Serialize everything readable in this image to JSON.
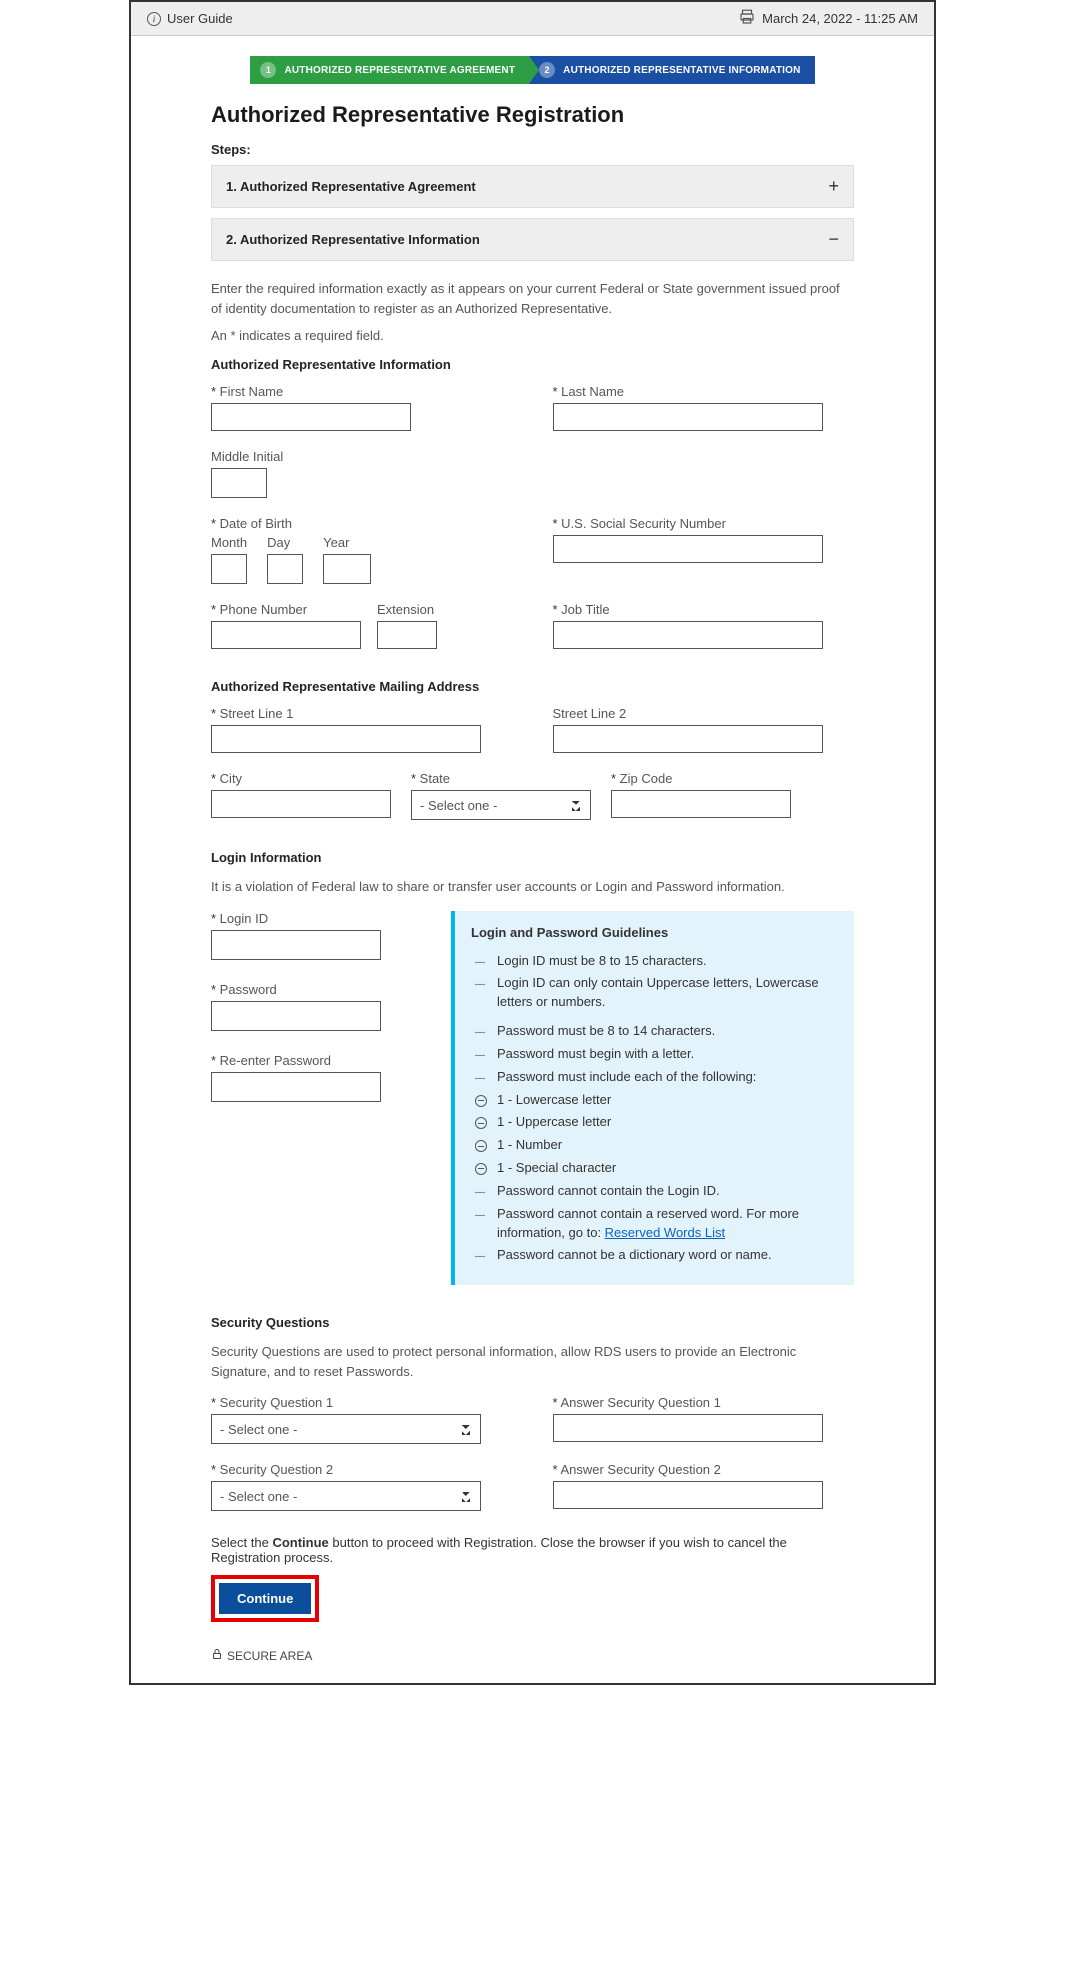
{
  "topbar": {
    "user_guide": "User Guide",
    "datetime": "March 24, 2022 - 11:25 AM"
  },
  "stepper": {
    "step1": {
      "num": "1",
      "label": "AUTHORIZED REPRESENTATIVE AGREEMENT"
    },
    "step2": {
      "num": "2",
      "label": "AUTHORIZED REPRESENTATIVE INFORMATION"
    }
  },
  "page_title": "Authorized Representative Registration",
  "steps_label": "Steps:",
  "accordion": {
    "item1": "1. Authorized Representative Agreement",
    "item2": "2. Authorized Representative Information"
  },
  "instructions": "Enter the required information exactly as it appears on your current Federal or State government issued proof of identity documentation to register as an Authorized Representative.",
  "required_note": "An * indicates a required field.",
  "section1_head": "Authorized Representative Information",
  "labels": {
    "first_name": "First Name",
    "last_name": "Last Name",
    "middle_initial": "Middle Initial",
    "dob": "Date of Birth",
    "month": "Month",
    "day": "Day",
    "year": "Year",
    "ssn": "U.S. Social Security Number",
    "phone": "Phone Number",
    "extension": "Extension",
    "job_title": "Job Title",
    "street1": "Street Line 1",
    "street2": "Street Line 2",
    "city": "City",
    "state": "State",
    "zip": "Zip Code",
    "login_id": "Login ID",
    "password": "Password",
    "reenter": "Re-enter Password",
    "sq1": "Security Question 1",
    "ans1": "Answer Security Question 1",
    "sq2": "Security Question 2",
    "ans2": "Answer Security Question 2"
  },
  "section2_head": "Authorized Representative Mailing Address",
  "section3_head": "Login Information",
  "login_note": "It is a violation of Federal law to share or transfer user accounts or Login and Password information.",
  "guidelines": {
    "title": "Login and Password Guidelines",
    "items": [
      "Login ID must be 8 to 15 characters.",
      "Login ID can only contain Uppercase letters, Lowercase letters or numbers.",
      "Password must be 8 to 14 characters.",
      "Password must begin with a letter.",
      "Password must include each of the following:",
      "1 - Lowercase letter",
      "1 - Uppercase letter",
      "1 - Number",
      "1 - Special character",
      "Password cannot contain the Login ID.",
      "Password cannot contain a reserved word. For more information, go to: ",
      "Reserved Words List",
      "Password cannot be a dictionary word or name."
    ]
  },
  "section4_head": "Security Questions",
  "sq_note": "Security Questions are used to protect personal information, allow RDS users to provide an Electronic Signature, and to reset Passwords.",
  "select_placeholder": "- Select one -",
  "continue_note_pre": "Select the ",
  "continue_note_bold": "Continue",
  "continue_note_post": " button to proceed with Registration. Close the browser if you wish to cancel the Registration process.",
  "continue_btn": "Continue",
  "secure": "SECURE AREA"
}
